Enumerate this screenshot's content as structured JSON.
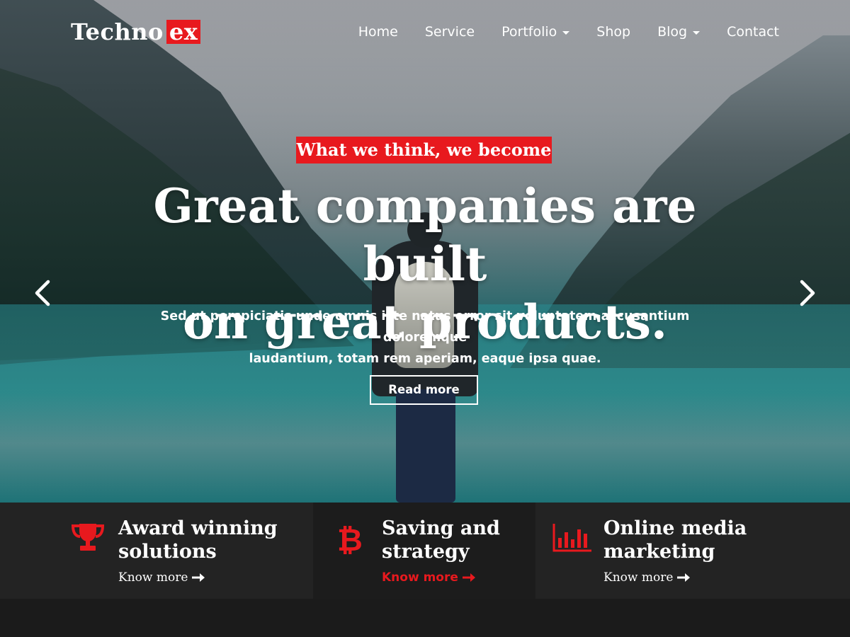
{
  "brand": {
    "logo_main": "Techno",
    "logo_accent": "ex",
    "accent_color": "#e8191e"
  },
  "nav": {
    "items": [
      {
        "label": "Home",
        "has_dropdown": false
      },
      {
        "label": "Service",
        "has_dropdown": false
      },
      {
        "label": "Portfolio",
        "has_dropdown": true
      },
      {
        "label": "Shop",
        "has_dropdown": false
      },
      {
        "label": "Blog",
        "has_dropdown": true
      },
      {
        "label": "Contact",
        "has_dropdown": false
      }
    ]
  },
  "hero": {
    "tagline": "What we think, we become",
    "headline_line1": "Great companies are built",
    "headline_line2": "on great products.",
    "subtext_line1": "Sed ut perspiciatis unde omnis iste natus error sit voluptatem accusantium doloremque",
    "subtext_line2": "laudantium, totam rem aperiam, eaque ipsa quae.",
    "button_label": "Read more",
    "prev_icon": "chevron-left-icon",
    "next_icon": "chevron-right-icon"
  },
  "features": [
    {
      "icon": "trophy-icon",
      "title_line1": "Award winning",
      "title_line2": "solutions",
      "link": "Know more"
    },
    {
      "icon": "bitcoin-icon",
      "title_line1": "Saving and",
      "title_line2": "strategy",
      "link": "Know more"
    },
    {
      "icon": "bar-chart-icon",
      "title_line1": "Online media",
      "title_line2": "marketing",
      "link": "Know more"
    }
  ]
}
